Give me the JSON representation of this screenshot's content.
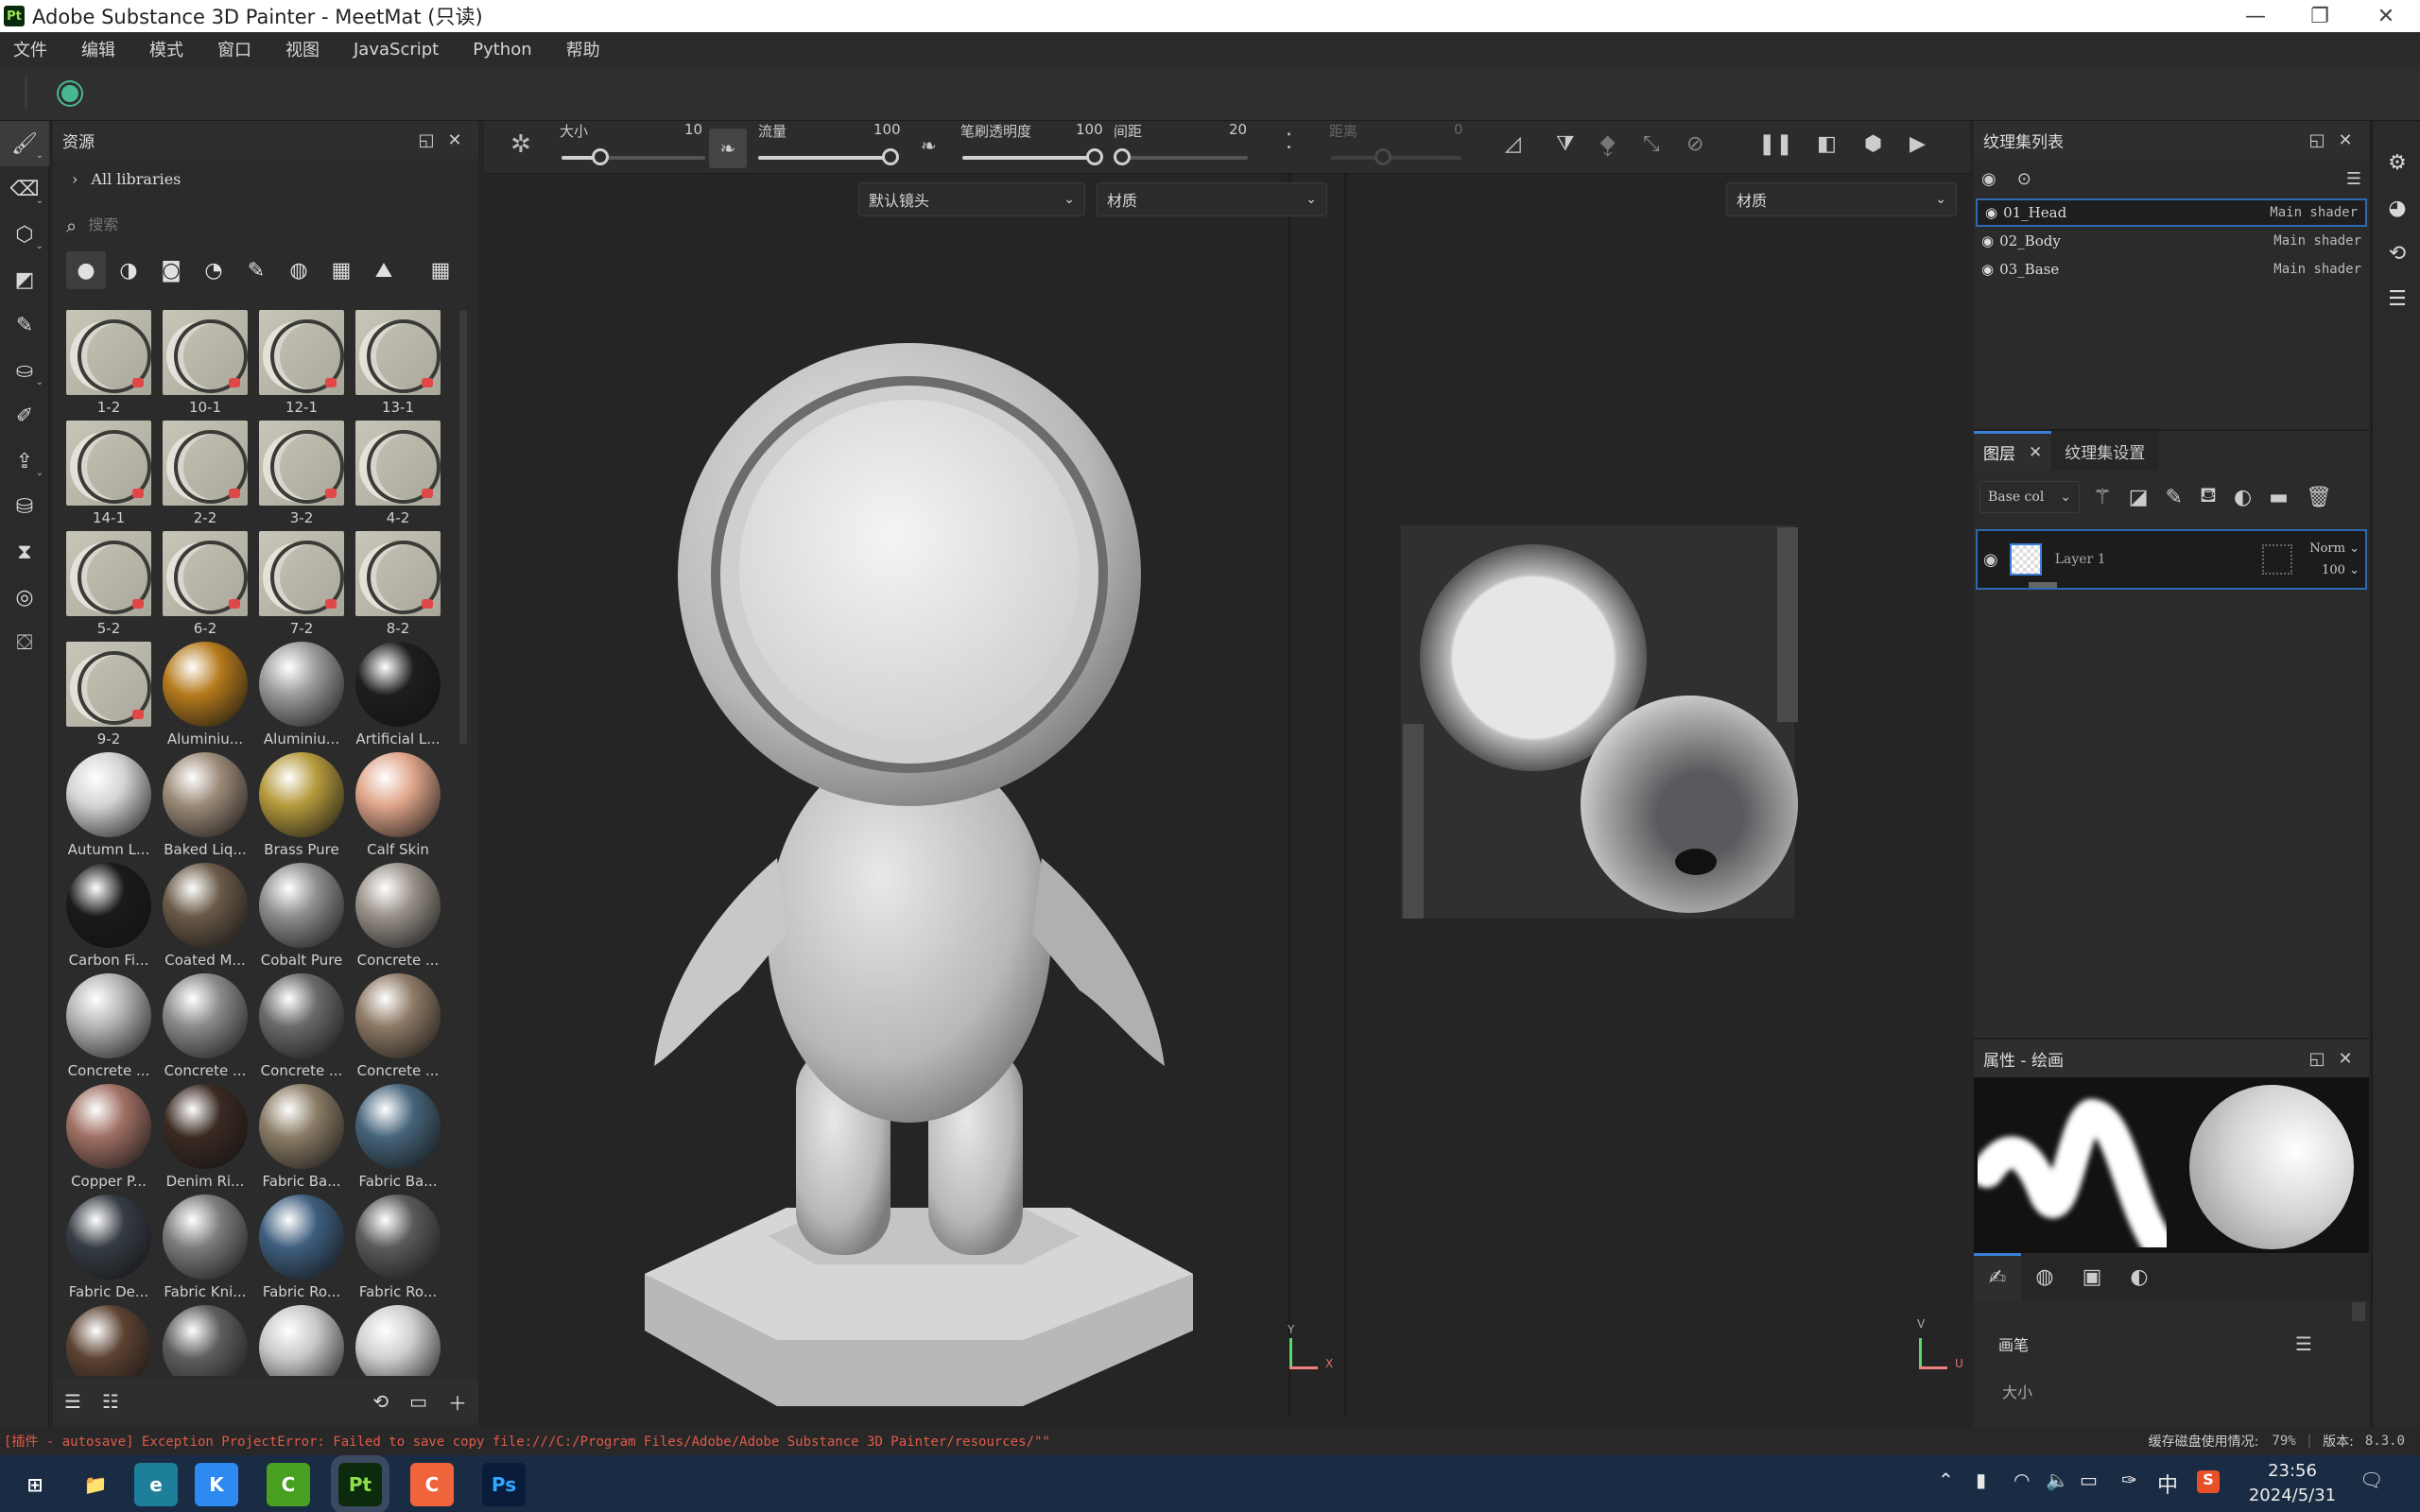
{
  "window": {
    "title": "Adobe Substance 3D Painter - MeetMat (只读)",
    "app_logo": "Pt",
    "controls": {
      "minimize": "—",
      "restore": "❐",
      "close": "✕"
    }
  },
  "menu": [
    "文件",
    "编辑",
    "模式",
    "窗口",
    "视图",
    "JavaScript",
    "Python",
    "帮助"
  ],
  "left_tools": [
    {
      "name": "paint-brush-icon",
      "glyph": "🖌",
      "active": true,
      "caret": true
    },
    {
      "name": "eraser-icon",
      "glyph": "⌫",
      "caret": true
    },
    {
      "name": "projection-icon",
      "glyph": "⬡",
      "caret": true
    },
    {
      "name": "polygon-fill-icon",
      "glyph": "◩"
    },
    {
      "name": "smudge-icon",
      "glyph": "✎"
    },
    {
      "name": "clone-stamp-icon",
      "glyph": "⛀",
      "caret": true
    },
    {
      "name": "color-picker-icon",
      "glyph": "✐"
    },
    {
      "name": "export-icon",
      "glyph": "⇪",
      "caret": true
    },
    {
      "name": "bake-icon",
      "glyph": "⛁"
    },
    {
      "name": "hourglass-icon",
      "glyph": "⧗"
    },
    {
      "name": "iray-icon",
      "glyph": "◎"
    },
    {
      "name": "scene-icon",
      "glyph": "⛋"
    }
  ],
  "assets": {
    "title": "资源",
    "library": "All libraries",
    "search_placeholder": "搜索",
    "filters": [
      "material-filter-icon",
      "smart-material-filter-icon",
      "smart-mask-filter-icon",
      "filter-icon",
      "brush-filter-icon",
      "alpha-filter-icon",
      "grunge-filter-icon",
      "environment-filter-icon",
      "grid-view-icon"
    ],
    "items": [
      {
        "label": "1-2",
        "kind": "sq"
      },
      {
        "label": "10-1",
        "kind": "sq"
      },
      {
        "label": "12-1",
        "kind": "sq"
      },
      {
        "label": "13-1",
        "kind": "sq"
      },
      {
        "label": "14-1",
        "kind": "sq"
      },
      {
        "label": "2-2",
        "kind": "sq"
      },
      {
        "label": "3-2",
        "kind": "sq"
      },
      {
        "label": "4-2",
        "kind": "sq"
      },
      {
        "label": "5-2",
        "kind": "sq"
      },
      {
        "label": "6-2",
        "kind": "sq"
      },
      {
        "label": "7-2",
        "kind": "sq"
      },
      {
        "label": "8-2",
        "kind": "sq"
      },
      {
        "label": "9-2",
        "kind": "sq"
      },
      {
        "label": "Aluminiu...",
        "color": "#b57a1c"
      },
      {
        "label": "Aluminiu...",
        "color": "#9a9a9a"
      },
      {
        "label": "Artificial L...",
        "color": "#1e1e1e"
      },
      {
        "label": "Autumn L...",
        "color": "#d4d4d4"
      },
      {
        "label": "Baked Liq...",
        "color": "#9c8a78"
      },
      {
        "label": "Brass Pure",
        "color": "#b59a3c"
      },
      {
        "label": "Calf Skin",
        "color": "#e0a58a"
      },
      {
        "label": "Carbon Fi...",
        "color": "#1a1a1a"
      },
      {
        "label": "Coated M...",
        "color": "#6a5a48"
      },
      {
        "label": "Cobalt Pure",
        "color": "#8e8e8e"
      },
      {
        "label": "Concrete ...",
        "color": "#9a928a"
      },
      {
        "label": "Concrete ...",
        "color": "#b4b4b4"
      },
      {
        "label": "Concrete ...",
        "color": "#8a8a8a"
      },
      {
        "label": "Concrete ...",
        "color": "#6a6a6a"
      },
      {
        "label": "Concrete ...",
        "color": "#8e7a66"
      },
      {
        "label": "Copper P...",
        "color": "#a07064"
      },
      {
        "label": "Denim Ri...",
        "color": "#3a2a22"
      },
      {
        "label": "Fabric Ba...",
        "color": "#8a7c66"
      },
      {
        "label": "Fabric Ba...",
        "color": "#46647a"
      },
      {
        "label": "Fabric De...",
        "color": "#363c44"
      },
      {
        "label": "Fabric Kni...",
        "color": "#7c7c7c"
      },
      {
        "label": "Fabric Ro...",
        "color": "#3e5e7e"
      },
      {
        "label": "Fabric Ro...",
        "color": "#5a5a5a"
      },
      {
        "label": "",
        "color": "#5c4232"
      },
      {
        "label": "",
        "color": "#5e5e5e"
      },
      {
        "label": "",
        "color": "#c8c8c8"
      },
      {
        "label": "",
        "color": "#cfcfcf"
      }
    ],
    "footer_icons": [
      "save-preset-icon",
      "import-folder-icon",
      "refresh-icon",
      "new-window-icon",
      "add-icon"
    ]
  },
  "toolbar": {
    "size": {
      "label": "大小",
      "value": "10",
      "fraction": 0.27
    },
    "flow": {
      "label": "流量",
      "value": "100",
      "fraction": 1.0
    },
    "opacity": {
      "label": "笔刷透明度",
      "value": "100",
      "fraction": 1.0
    },
    "spacing": {
      "label": "间距",
      "value": "20",
      "fraction": 0.05
    },
    "distance": {
      "label": "距离",
      "value": "0",
      "fraction": 0.4
    }
  },
  "viewport": {
    "camera_dropdown": "默认镜头",
    "mode_dropdown_3d": "材质",
    "mode_dropdown_2d": "材质",
    "axis_3d": {
      "y": "Y",
      "x": "X"
    },
    "axis_2d": {
      "v": "V",
      "u": "U"
    }
  },
  "texture_sets": {
    "title": "纹理集列表",
    "rows": [
      {
        "name": "01_Head",
        "shader": "Main shader",
        "selected": true
      },
      {
        "name": "02_Body",
        "shader": "Main shader"
      },
      {
        "name": "03_Base",
        "shader": "Main shader"
      }
    ]
  },
  "layers": {
    "tab_layers": "图层",
    "tab_settings": "纹理集设置",
    "channel": "Base col",
    "layer": {
      "name": "Layer 1",
      "blend": "Norm",
      "opacity": "100"
    }
  },
  "properties": {
    "title": "属性 - 绘画",
    "section": "画笔",
    "field": "大小"
  },
  "status": {
    "error": "[插件 - autosave] Exception ProjectError: Failed to save copy file:///C:/Program Files/Adobe/Adobe Substance 3D Painter/resources/\"\"",
    "cache_label": "缓存磁盘使用情况:",
    "cache_value": "79%",
    "version_label": "版本:",
    "version_value": "8.3.0",
    "error_color": "#e05a4a"
  },
  "taskbar": {
    "time": "23:56",
    "date": "2024/5/31",
    "ime": "中",
    "apps": [
      {
        "name": "start-button",
        "label": "⊞",
        "bg": "transparent",
        "fg": "#fff"
      },
      {
        "name": "file-explorer-icon",
        "label": "📁",
        "bg": "transparent",
        "fg": "#f4c24a"
      },
      {
        "name": "edge-icon",
        "label": "e",
        "bg": "#1d7f9a",
        "fg": "#fff"
      },
      {
        "name": "kugou-icon",
        "label": "K",
        "bg": "#2c8af0",
        "fg": "#fff"
      },
      {
        "name": "camtasia-green-icon",
        "label": "C",
        "bg": "#4aa020",
        "fg": "#fff"
      },
      {
        "name": "substance-painter-icon",
        "label": "Pt",
        "bg": "#0c2a0c",
        "fg": "#8fe04a"
      },
      {
        "name": "camtasia-orange-icon",
        "label": "C",
        "bg": "#f0643c",
        "fg": "#fff"
      },
      {
        "name": "photoshop-icon",
        "label": "Ps",
        "bg": "#0a1c3c",
        "fg": "#31a8ff"
      }
    ]
  }
}
